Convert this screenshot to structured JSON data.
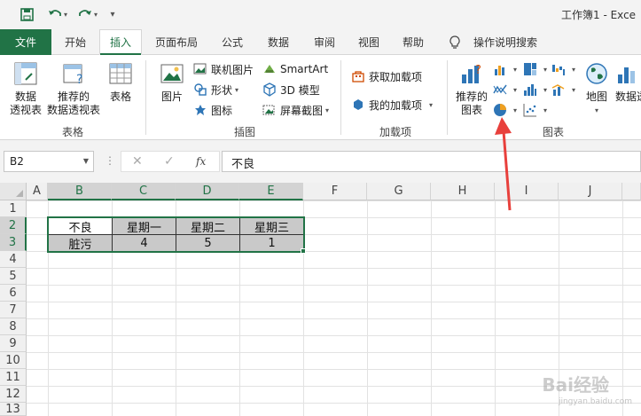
{
  "window": {
    "title": "工作簿1  -  Exce"
  },
  "tabs": [
    {
      "label": "文件"
    },
    {
      "label": "开始"
    },
    {
      "label": "插入"
    },
    {
      "label": "页面布局"
    },
    {
      "label": "公式"
    },
    {
      "label": "数据"
    },
    {
      "label": "审阅"
    },
    {
      "label": "视图"
    },
    {
      "label": "帮助"
    },
    {
      "label": "操作说明搜索"
    }
  ],
  "ribbon": {
    "tables": {
      "pivot": "数据\n透视表",
      "recommended_pivot": "推荐的\n数据透视表",
      "table": "表格",
      "group": "表格"
    },
    "illustrations": {
      "picture": "图片",
      "online_picture": "联机图片",
      "shapes": "形状",
      "icons": "图标",
      "smartart": "SmartArt",
      "model3d": "3D 模型",
      "screenshot": "屏幕截图",
      "group": "插图"
    },
    "addins": {
      "get": "获取加载项",
      "mine": "我的加载项",
      "group": "加载项"
    },
    "charts": {
      "recommended": "推荐的\n图表",
      "map": "地图",
      "pivotchart": "数据透",
      "group": "图表"
    }
  },
  "formula_bar": {
    "name_box": "B2",
    "fx": "fx",
    "value": "不良"
  },
  "columns": [
    "A",
    "B",
    "C",
    "D",
    "E",
    "F",
    "G",
    "H",
    "I",
    "J"
  ],
  "rows": [
    "1",
    "2",
    "3",
    "4",
    "5",
    "6",
    "7",
    "8",
    "9",
    "10",
    "11",
    "12",
    "13"
  ],
  "table": {
    "header": [
      "不良",
      "星期一",
      "星期二",
      "星期三"
    ],
    "row": [
      "脏污",
      "4",
      "5",
      "1"
    ]
  },
  "watermark": {
    "main": "Bai经验",
    "sub": "jingyan.baidu.com"
  },
  "colors": {
    "accent": "#217346",
    "arrow": "#e8403c"
  }
}
